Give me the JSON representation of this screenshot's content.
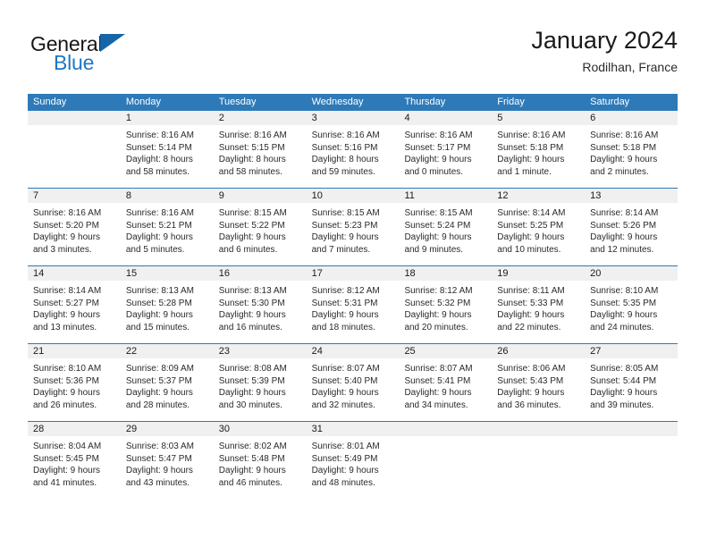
{
  "brand": {
    "name_top": "General",
    "name_bottom": "Blue",
    "triangle_color": "#1565a8",
    "blue_color": "#1f77c2"
  },
  "header": {
    "title": "January 2024",
    "subtitle": "Rodilhan, France"
  },
  "theme": {
    "header_blue": "#2e7ab8",
    "day_band_gray": "#f0f0f0",
    "text": "#1a1a1a"
  },
  "weekdays": [
    "Sunday",
    "Monday",
    "Tuesday",
    "Wednesday",
    "Thursday",
    "Friday",
    "Saturday"
  ],
  "weeks": [
    [
      {
        "date": "",
        "sunrise": "",
        "sunset": "",
        "daylight": ""
      },
      {
        "date": "1",
        "sunrise": "Sunrise: 8:16 AM",
        "sunset": "Sunset: 5:14 PM",
        "daylight": "Daylight: 8 hours and 58 minutes."
      },
      {
        "date": "2",
        "sunrise": "Sunrise: 8:16 AM",
        "sunset": "Sunset: 5:15 PM",
        "daylight": "Daylight: 8 hours and 58 minutes."
      },
      {
        "date": "3",
        "sunrise": "Sunrise: 8:16 AM",
        "sunset": "Sunset: 5:16 PM",
        "daylight": "Daylight: 8 hours and 59 minutes."
      },
      {
        "date": "4",
        "sunrise": "Sunrise: 8:16 AM",
        "sunset": "Sunset: 5:17 PM",
        "daylight": "Daylight: 9 hours and 0 minutes."
      },
      {
        "date": "5",
        "sunrise": "Sunrise: 8:16 AM",
        "sunset": "Sunset: 5:18 PM",
        "daylight": "Daylight: 9 hours and 1 minute."
      },
      {
        "date": "6",
        "sunrise": "Sunrise: 8:16 AM",
        "sunset": "Sunset: 5:18 PM",
        "daylight": "Daylight: 9 hours and 2 minutes."
      }
    ],
    [
      {
        "date": "7",
        "sunrise": "Sunrise: 8:16 AM",
        "sunset": "Sunset: 5:20 PM",
        "daylight": "Daylight: 9 hours and 3 minutes."
      },
      {
        "date": "8",
        "sunrise": "Sunrise: 8:16 AM",
        "sunset": "Sunset: 5:21 PM",
        "daylight": "Daylight: 9 hours and 5 minutes."
      },
      {
        "date": "9",
        "sunrise": "Sunrise: 8:15 AM",
        "sunset": "Sunset: 5:22 PM",
        "daylight": "Daylight: 9 hours and 6 minutes."
      },
      {
        "date": "10",
        "sunrise": "Sunrise: 8:15 AM",
        "sunset": "Sunset: 5:23 PM",
        "daylight": "Daylight: 9 hours and 7 minutes."
      },
      {
        "date": "11",
        "sunrise": "Sunrise: 8:15 AM",
        "sunset": "Sunset: 5:24 PM",
        "daylight": "Daylight: 9 hours and 9 minutes."
      },
      {
        "date": "12",
        "sunrise": "Sunrise: 8:14 AM",
        "sunset": "Sunset: 5:25 PM",
        "daylight": "Daylight: 9 hours and 10 minutes."
      },
      {
        "date": "13",
        "sunrise": "Sunrise: 8:14 AM",
        "sunset": "Sunset: 5:26 PM",
        "daylight": "Daylight: 9 hours and 12 minutes."
      }
    ],
    [
      {
        "date": "14",
        "sunrise": "Sunrise: 8:14 AM",
        "sunset": "Sunset: 5:27 PM",
        "daylight": "Daylight: 9 hours and 13 minutes."
      },
      {
        "date": "15",
        "sunrise": "Sunrise: 8:13 AM",
        "sunset": "Sunset: 5:28 PM",
        "daylight": "Daylight: 9 hours and 15 minutes."
      },
      {
        "date": "16",
        "sunrise": "Sunrise: 8:13 AM",
        "sunset": "Sunset: 5:30 PM",
        "daylight": "Daylight: 9 hours and 16 minutes."
      },
      {
        "date": "17",
        "sunrise": "Sunrise: 8:12 AM",
        "sunset": "Sunset: 5:31 PM",
        "daylight": "Daylight: 9 hours and 18 minutes."
      },
      {
        "date": "18",
        "sunrise": "Sunrise: 8:12 AM",
        "sunset": "Sunset: 5:32 PM",
        "daylight": "Daylight: 9 hours and 20 minutes."
      },
      {
        "date": "19",
        "sunrise": "Sunrise: 8:11 AM",
        "sunset": "Sunset: 5:33 PM",
        "daylight": "Daylight: 9 hours and 22 minutes."
      },
      {
        "date": "20",
        "sunrise": "Sunrise: 8:10 AM",
        "sunset": "Sunset: 5:35 PM",
        "daylight": "Daylight: 9 hours and 24 minutes."
      }
    ],
    [
      {
        "date": "21",
        "sunrise": "Sunrise: 8:10 AM",
        "sunset": "Sunset: 5:36 PM",
        "daylight": "Daylight: 9 hours and 26 minutes."
      },
      {
        "date": "22",
        "sunrise": "Sunrise: 8:09 AM",
        "sunset": "Sunset: 5:37 PM",
        "daylight": "Daylight: 9 hours and 28 minutes."
      },
      {
        "date": "23",
        "sunrise": "Sunrise: 8:08 AM",
        "sunset": "Sunset: 5:39 PM",
        "daylight": "Daylight: 9 hours and 30 minutes."
      },
      {
        "date": "24",
        "sunrise": "Sunrise: 8:07 AM",
        "sunset": "Sunset: 5:40 PM",
        "daylight": "Daylight: 9 hours and 32 minutes."
      },
      {
        "date": "25",
        "sunrise": "Sunrise: 8:07 AM",
        "sunset": "Sunset: 5:41 PM",
        "daylight": "Daylight: 9 hours and 34 minutes."
      },
      {
        "date": "26",
        "sunrise": "Sunrise: 8:06 AM",
        "sunset": "Sunset: 5:43 PM",
        "daylight": "Daylight: 9 hours and 36 minutes."
      },
      {
        "date": "27",
        "sunrise": "Sunrise: 8:05 AM",
        "sunset": "Sunset: 5:44 PM",
        "daylight": "Daylight: 9 hours and 39 minutes."
      }
    ],
    [
      {
        "date": "28",
        "sunrise": "Sunrise: 8:04 AM",
        "sunset": "Sunset: 5:45 PM",
        "daylight": "Daylight: 9 hours and 41 minutes."
      },
      {
        "date": "29",
        "sunrise": "Sunrise: 8:03 AM",
        "sunset": "Sunset: 5:47 PM",
        "daylight": "Daylight: 9 hours and 43 minutes."
      },
      {
        "date": "30",
        "sunrise": "Sunrise: 8:02 AM",
        "sunset": "Sunset: 5:48 PM",
        "daylight": "Daylight: 9 hours and 46 minutes."
      },
      {
        "date": "31",
        "sunrise": "Sunrise: 8:01 AM",
        "sunset": "Sunset: 5:49 PM",
        "daylight": "Daylight: 9 hours and 48 minutes."
      },
      {
        "date": "",
        "sunrise": "",
        "sunset": "",
        "daylight": ""
      },
      {
        "date": "",
        "sunrise": "",
        "sunset": "",
        "daylight": ""
      },
      {
        "date": "",
        "sunrise": "",
        "sunset": "",
        "daylight": ""
      }
    ]
  ]
}
